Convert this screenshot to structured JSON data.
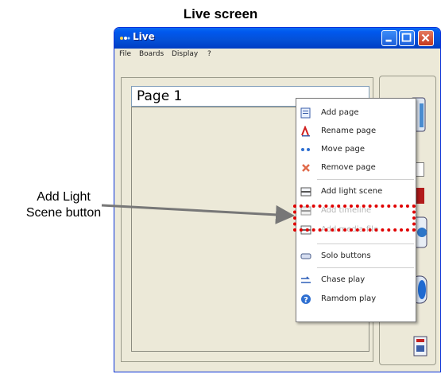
{
  "caption": "Live screen",
  "annotation": {
    "line1": "Add Light",
    "line2": "Scene button"
  },
  "window": {
    "title": "Live",
    "menu": [
      "File",
      "Boards",
      "Display",
      "?"
    ]
  },
  "page": {
    "title": "Page  1"
  },
  "context_menu": {
    "items": [
      {
        "label": "Add page",
        "icon": "add-page-icon",
        "enabled": true
      },
      {
        "label": "Rename page",
        "icon": "rename-icon",
        "enabled": true
      },
      {
        "label": "Move page",
        "icon": "move-icon",
        "enabled": true
      },
      {
        "label": "Remove page",
        "icon": "remove-icon",
        "enabled": true
      },
      {
        "label": "Add light scene",
        "icon": "light-scene-icon",
        "enabled": true
      },
      {
        "label": "Add timeline",
        "icon": "timeline-icon",
        "enabled": false
      },
      {
        "label": "Add media file",
        "icon": "media-file-icon",
        "enabled": false
      },
      {
        "label": "Solo buttons",
        "icon": "solo-buttons-icon",
        "enabled": true
      },
      {
        "label": "Chase play",
        "icon": "chase-play-icon",
        "enabled": true
      },
      {
        "label": "Ramdom play",
        "icon": "random-play-icon",
        "enabled": true
      }
    ]
  },
  "colors": {
    "titlebar": "#0058EE",
    "highlight": "#E00000",
    "window_bg": "#ECE9D8"
  }
}
